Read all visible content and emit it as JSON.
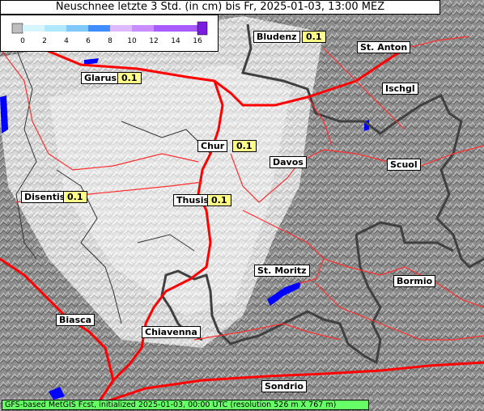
{
  "title": "Neuschnee letzte 3 Std. (in cm) bis Fr, 2025-01-03, 13:00 MEZ",
  "legend": {
    "ticks": [
      "0",
      "2",
      "4",
      "6",
      "8",
      "10",
      "12",
      "14",
      "16"
    ],
    "colors": [
      "#bfbfbf",
      "#d5f6ff",
      "#b0e8ff",
      "#7fc9ff",
      "#3f8dff",
      "#ddb9ff",
      "#c98dff",
      "#a85cff",
      "#7a1fe0"
    ]
  },
  "places": {
    "bludenz": "Bludenz",
    "st_anton": "St. Anton",
    "glarus": "Glarus",
    "ischgl": "Ischgl",
    "chur": "Chur",
    "davos": "Davos",
    "scuol": "Scuol",
    "disentis": "Disentis",
    "thusis": "Thusis",
    "st_moritz": "St. Moritz",
    "bormio": "Bormio",
    "biasca": "Biasca",
    "chiavenna": "Chiavenna",
    "sondrio": "Sondrio"
  },
  "values": {
    "bludenz": "0.1",
    "glarus": "0.1",
    "chur": "0.1",
    "disentis": "0.1",
    "thusis": "0.1"
  },
  "colors": {
    "roads": "#ff0000",
    "border": "#404040",
    "lakes": "#0000ff",
    "snow_area": "#ffffff",
    "footer": "#66ff66",
    "value_box": "#ffff88"
  },
  "footer": "GFS-based MetGIS Fcst, initialized 2025-01-03, 00:00 UTC  (resolution 526 m X 767 m)"
}
